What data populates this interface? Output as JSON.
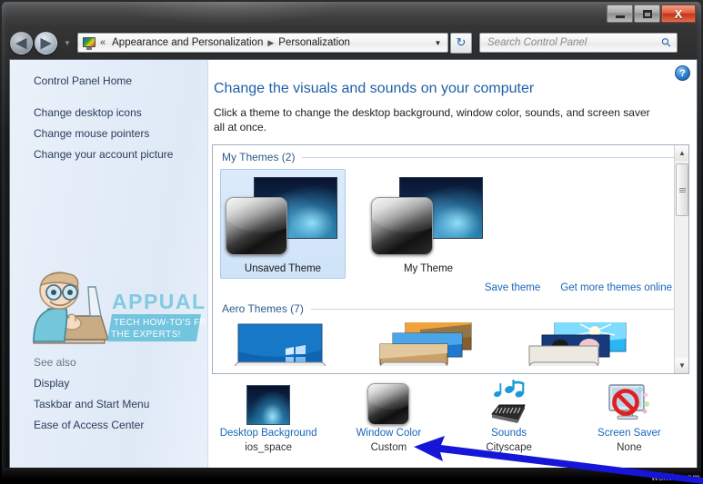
{
  "window": {
    "caption_buttons": {
      "minimize_label": "Minimize",
      "maximize_label": "Maximize",
      "close_label": "X"
    }
  },
  "toolbar": {
    "back_glyph": "◀",
    "forward_glyph": "▶",
    "history_drop_glyph": "▼",
    "address_chevron": "«",
    "breadcrumbs": [
      {
        "label": "Appearance and Personalization"
      },
      {
        "label": "Personalization"
      }
    ],
    "breadcrumb_separator": "▶",
    "address_dropdown_glyph": "▼",
    "refresh_glyph": "↻",
    "search": {
      "placeholder": "Search Control Panel",
      "value": "",
      "icon": "search-icon"
    }
  },
  "sidebar": {
    "home_label": "Control Panel Home",
    "items": [
      {
        "label": "Change desktop icons"
      },
      {
        "label": "Change mouse pointers"
      },
      {
        "label": "Change your account picture"
      }
    ],
    "see_also_label": "See also",
    "see_also_items": [
      {
        "label": "Display"
      },
      {
        "label": "Taskbar and Start Menu"
      },
      {
        "label": "Ease of Access Center"
      }
    ],
    "watermark": {
      "brand": "APPUALS",
      "tagline_line1": "TECH HOW-TO'S FROM",
      "tagline_line2": "THE EXPERTS!"
    }
  },
  "main": {
    "help_glyph": "?",
    "title": "Change the visuals and sounds on your computer",
    "description": "Click a theme to change the desktop background, window color, sounds, and screen saver all at once.",
    "groups": [
      {
        "title": "My Themes (2)",
        "themes": [
          {
            "name": "Unsaved Theme",
            "selected": true
          },
          {
            "name": "My Theme",
            "selected": false
          }
        ]
      },
      {
        "title": "Aero Themes (7)",
        "themes": []
      }
    ],
    "links": [
      {
        "label": "Save theme"
      },
      {
        "label": "Get more themes online"
      }
    ],
    "scrollbar": {
      "up_glyph": "▲",
      "down_glyph": "▼"
    },
    "settings": [
      {
        "title": "Desktop Background",
        "value": "ios_space",
        "icon": "wallpaper-icon"
      },
      {
        "title": "Window Color",
        "value": "Custom",
        "icon": "window-color-icon"
      },
      {
        "title": "Sounds",
        "value": "Cityscape",
        "icon": "sounds-icon"
      },
      {
        "title": "Screen Saver",
        "value": "None",
        "icon": "screen-saver-icon"
      }
    ]
  },
  "annotation": {
    "arrow_color": "#1616d8",
    "points_to": "Window Color"
  },
  "footer": {
    "watermark": "wsxdn.com"
  },
  "colors": {
    "accent_link": "#1866b8",
    "title_blue": "#1f5fa8",
    "selection_blue": "#cfe3f8"
  }
}
